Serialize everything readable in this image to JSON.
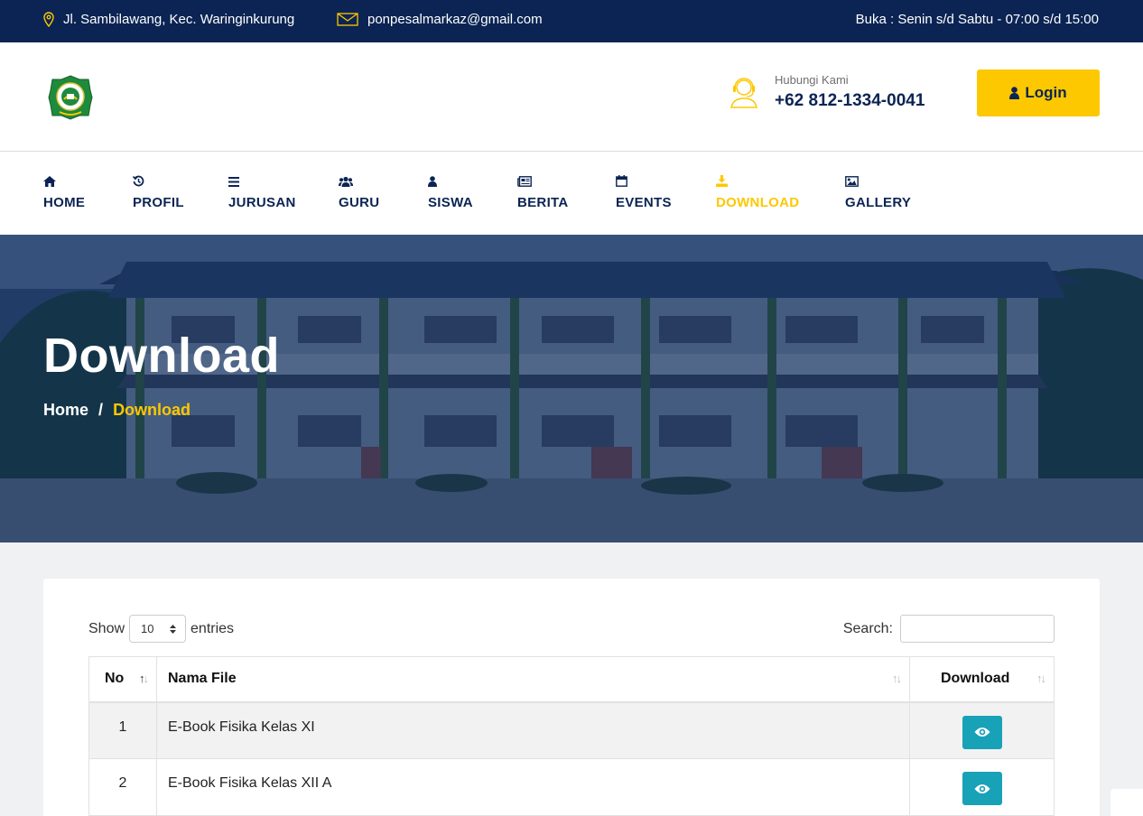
{
  "topbar": {
    "address": "Jl. Sambilawang, Kec. Waringinkurung",
    "email": "ponpesalmarkaz@gmail.com",
    "hours": "Buka : Senin s/d Sabtu - 07:00 s/d 15:00"
  },
  "header": {
    "contact_label": "Hubungi Kami",
    "contact_phone": "+62 812-1334-0041",
    "login_label": "Login"
  },
  "nav": {
    "items": [
      {
        "label": "HOME",
        "icon": "home-icon"
      },
      {
        "label": "PROFIL",
        "icon": "history-icon"
      },
      {
        "label": "JURUSAN",
        "icon": "bars-icon"
      },
      {
        "label": "GURU",
        "icon": "users-icon"
      },
      {
        "label": "SISWA",
        "icon": "user-icon"
      },
      {
        "label": "BERITA",
        "icon": "newspaper-icon"
      },
      {
        "label": "EVENTS",
        "icon": "calendar-icon"
      },
      {
        "label": "DOWNLOAD",
        "icon": "download-icon"
      },
      {
        "label": "GALLERY",
        "icon": "image-icon"
      }
    ],
    "active": "DOWNLOAD"
  },
  "hero": {
    "title": "Download",
    "breadcrumb_home": "Home",
    "breadcrumb_sep": "/",
    "breadcrumb_current": "Download"
  },
  "table_controls": {
    "show_label": "Show",
    "entries_value": "10",
    "entries_label": "entries",
    "search_label": "Search:"
  },
  "table": {
    "columns": [
      "No",
      "Nama File",
      "Download"
    ],
    "rows": [
      {
        "no": "1",
        "name": "E-Book Fisika Kelas XI"
      },
      {
        "no": "2",
        "name": "E-Book Fisika Kelas XII A"
      }
    ]
  },
  "colors": {
    "navy": "#0b2453",
    "accent": "#fdc800",
    "info": "#17a2b8"
  }
}
